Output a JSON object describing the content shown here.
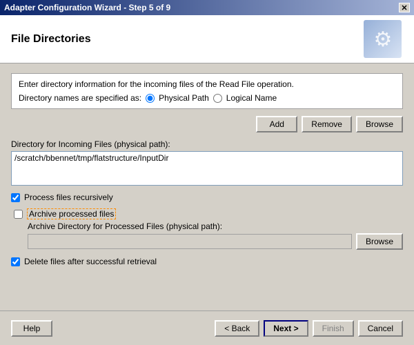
{
  "titleBar": {
    "title": "Adapter Configuration Wizard - Step 5 of 9",
    "closeBtn": "✕"
  },
  "header": {
    "title": "File Directories"
  },
  "infoBox": {
    "line1": "Enter directory information for the incoming files of the Read File operation.",
    "line2": "Directory names are specified as:"
  },
  "radioOptions": {
    "physicalPath": "Physical Path",
    "logicalName": "Logical Name"
  },
  "buttons": {
    "add": "Add",
    "remove": "Remove",
    "browse": "Browse"
  },
  "dirLabel": "Directory for Incoming Files (physical path):",
  "dirValue": "/scratch/bbennet/tmp/flatstructure/InputDir",
  "processFilesLabel": "Process files recursively",
  "archiveLabel": "Archive processed files",
  "archiveDirLabel": "Archive Directory for Processed Files (physical path):",
  "archiveBrowse": "Browse",
  "deleteFilesLabel": "Delete files after successful retrieval",
  "footer": {
    "help": "Help",
    "back": "< Back",
    "next": "Next >",
    "finish": "Finish",
    "cancel": "Cancel"
  }
}
